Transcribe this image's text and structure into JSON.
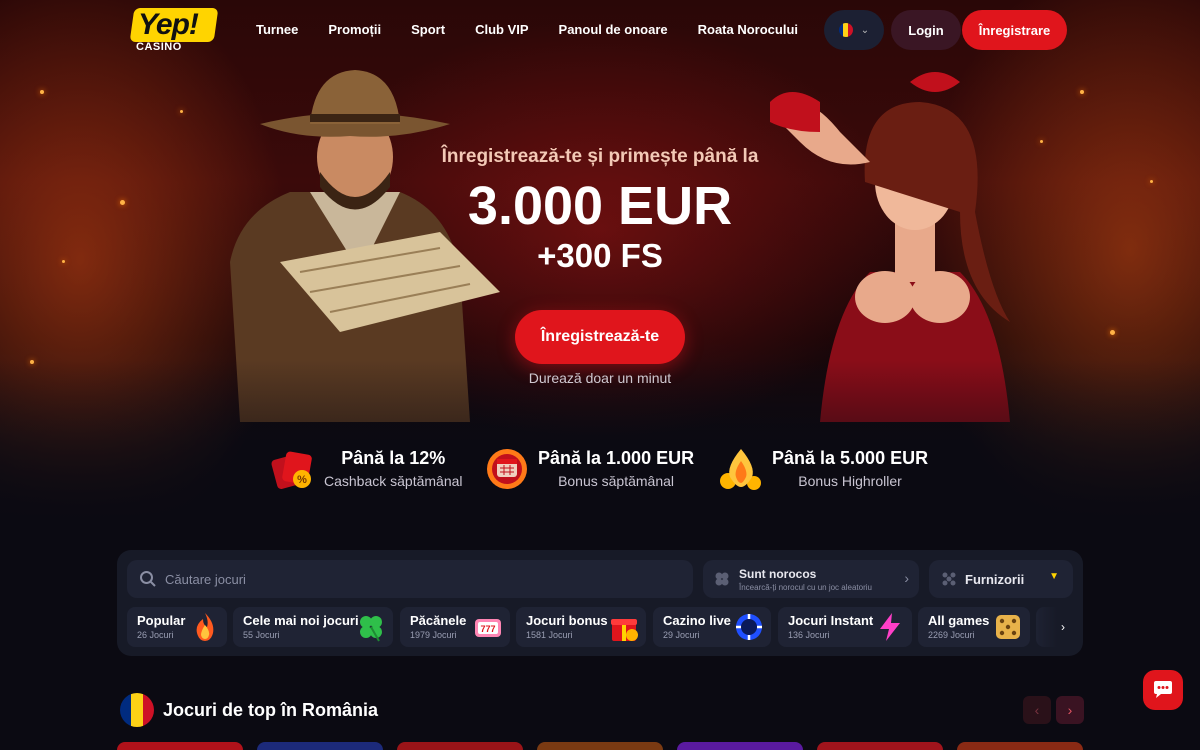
{
  "brand": {
    "logo_text": "Yep!",
    "logo_sub": "CASINO"
  },
  "nav": [
    "Turnee",
    "Promoții",
    "Sport",
    "Club VIP",
    "Panoul de onoare",
    "Roata Norocului"
  ],
  "header": {
    "login_label": "Login",
    "register_label": "Înregistrare",
    "language_flag": "romania-flag-icon"
  },
  "hero": {
    "subtitle": "Înregistrează-te și primește până la",
    "amount": "3.000 EUR",
    "free_spins": "+300 FS",
    "cta_label": "Înregistrează-te",
    "note": "Durează doar un minut"
  },
  "bonuses": [
    {
      "title": "Până la 12%",
      "desc": "Cashback săptămânal",
      "icon": "cashback-icon"
    },
    {
      "title": "Până la 1.000 EUR",
      "desc": "Bonus săptămânal",
      "icon": "calendar-bonus-icon"
    },
    {
      "title": "Până la 5.000 EUR",
      "desc": "Bonus Highroller",
      "icon": "highroller-icon"
    }
  ],
  "games_panel": {
    "search_placeholder": "Căutare jocuri",
    "lucky_title": "Sunt norocos",
    "lucky_subtitle": "Încearcă-ți norocul cu un joc aleatoriu",
    "providers_label": "Furnizorii",
    "categories": [
      {
        "title": "Popular",
        "count": "26 Jocuri",
        "icon": "fire-icon"
      },
      {
        "title": "Cele mai noi jocuri",
        "count": "55 Jocuri",
        "icon": "clover-icon"
      },
      {
        "title": "Păcănele",
        "count": "1979 Jocuri",
        "icon": "slot-machine-icon"
      },
      {
        "title": "Jocuri bonus",
        "count": "1581 Jocuri",
        "icon": "gift-icon"
      },
      {
        "title": "Cazino live",
        "count": "29 Jocuri",
        "icon": "poker-chip-icon"
      },
      {
        "title": "Jocuri Instant",
        "count": "136 Jocuri",
        "icon": "lightning-icon"
      },
      {
        "title": "All games",
        "count": "2269 Jocuri",
        "icon": "dice-icon"
      }
    ]
  },
  "section": {
    "title": "Jocuri de top în România"
  },
  "colors": {
    "accent": "#e0151c",
    "brand_yellow": "#ffd400",
    "panel": "#171a27"
  }
}
